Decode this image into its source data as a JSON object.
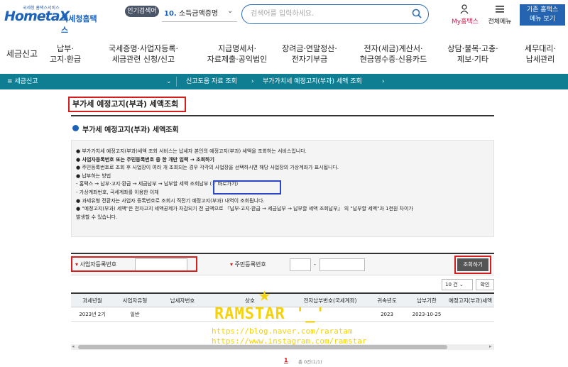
{
  "header": {
    "logo_small": "국세청 홈택스서비스",
    "logo_main": "HometaX",
    "logo_sub": "국세청홈택스",
    "popular_badge": "인기검색어",
    "popular_num": "10.",
    "popular_text": "소득금액증명",
    "search_placeholder": "검색어를 입력하세요.",
    "my_label": "My홈택스",
    "menu_label": "전체메뉴",
    "old_line1": "기존 홈택스",
    "old_line2": "메뉴 보기"
  },
  "gnb": [
    {
      "l1": "세금신고",
      "l2": ""
    },
    {
      "l1": "납부·",
      "l2": "고지·환급"
    },
    {
      "l1": "국세증명·사업자등록·",
      "l2": "세금관련 신청/신고"
    },
    {
      "l1": "지급명세서·",
      "l2": "자료제출·공익법인"
    },
    {
      "l1": "장려금·연말정산·",
      "l2": "전자기부금"
    },
    {
      "l1": "전자(세금)계산서·",
      "l2": "현금영수증·신용카드"
    },
    {
      "l1": "상담·불복·고충·",
      "l2": "제보·기타"
    },
    {
      "l1": "세무대리·",
      "l2": "납세관리"
    }
  ],
  "breadcrumb": {
    "home_label": "≡ 세금신고",
    "second": "신고도움 자료 조회",
    "third": "부가가치세 예정고지(부과) 세액 조회"
  },
  "page": {
    "title": "부가세 예정고지(부과) 세액조회",
    "subtitle": "부가세 예정고지(부과) 세액조회"
  },
  "info": {
    "lines": [
      "● 부가가치세 예정고지(부과)세액 조회 서비스는 납세자 본인의 예정고지(부과) 세액을 조회하는 서비스입니다.",
      "● 사업자등록번호 또는 주민등록번호 중 한 개만 입력 → 조회하기",
      "● 주민등록번호로 조회 후 사업장이 여러 개 조회되는 경우 각각의 사업장을 선택하시면 해당 사업장의 가상계좌가 표시됩니다.",
      "● 납부하는 방법",
      "  - 홈택스 → 납부·고지·환급 → 세금납부 → 납부할 세액 조회납부 (☞ 바로가기)",
      "  - 가상계좌번호, 국세계좌를 이용한 이체",
      "● 과세유형 전환자는 사업자 등록번호로 조회시 직전기 예정고지(부과) 내역이 조회됩니다.",
      "● \"예정고지(부과) 세액\"은 전자고지 세액공제가 차감되기 전 금액으로 『납부·고지·환급 → 세금납부 → 납부할 세액 조회납부』 의 \"납부할 세액\"과 1천원 차이가",
      "  발생할 수 있습니다."
    ]
  },
  "form": {
    "bizno_label": "사업자등록번호",
    "resno_label": "주민등록번호",
    "dash": "-",
    "search_btn": "조회하기"
  },
  "table": {
    "page_size": "10 건",
    "ok_btn": "확인",
    "headers": [
      "과세년월",
      "사업자유형",
      "납세자번호",
      "상호",
      "전자납부번호(국세계좌)",
      "귀속년도",
      "납부기한",
      "예정고지(부과)세액"
    ],
    "rows": [
      [
        "2023년 2기",
        "일반",
        "",
        "",
        "",
        "2023",
        "2023-10-25",
        ""
      ]
    ]
  },
  "pagination": {
    "current": "1",
    "total": "총 0건(1/1)"
  },
  "watermark": {
    "star": "★",
    "name": "RAMSTAR '_'",
    "blog": "https://blog.naver.com/raratam",
    "insta": "https://www.instagram.com/ramstar"
  }
}
